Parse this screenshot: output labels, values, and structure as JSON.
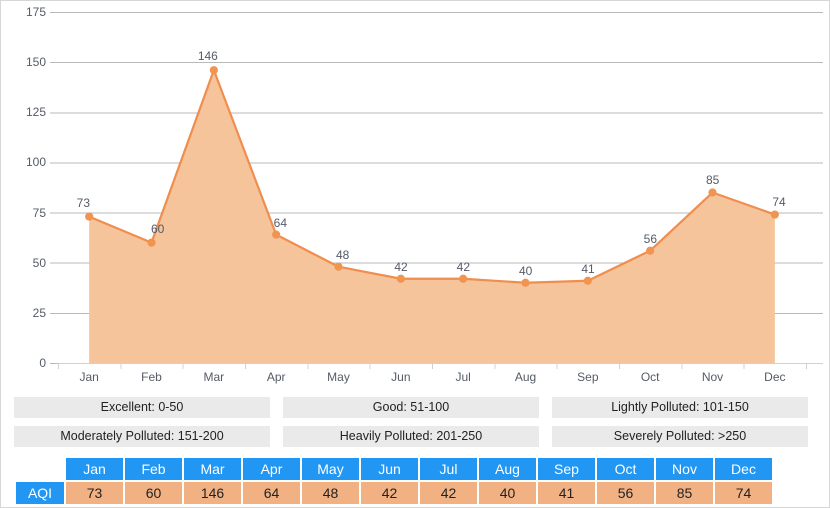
{
  "chart_data": {
    "type": "area",
    "title": "",
    "subtitle": "",
    "xlabel": "",
    "ylabel": "",
    "categories": [
      "Jan",
      "Feb",
      "Mar",
      "Apr",
      "May",
      "Jun",
      "Jul",
      "Aug",
      "Sep",
      "Oct",
      "Nov",
      "Dec"
    ],
    "series": [
      {
        "name": "AQI",
        "values": [
          73,
          60,
          146,
          64,
          48,
          42,
          42,
          40,
          41,
          56,
          85,
          74
        ]
      }
    ],
    "ylim": [
      0,
      175
    ],
    "yticks": [
      0,
      25,
      50,
      75,
      100,
      125,
      150,
      175
    ],
    "ytick_labels": [
      "0",
      "25",
      "50",
      "75",
      "100",
      "125",
      "150",
      "175"
    ],
    "grid": true,
    "legend_position": "below-chart",
    "data_labels": [
      "73",
      "60",
      "146",
      "64",
      "48",
      "42",
      "42",
      "40",
      "41",
      "56",
      "85",
      "74"
    ],
    "colors": {
      "line": "#ef8e4e",
      "marker": "#f09452",
      "area_fill": "#f5c49a",
      "gridline": "#b9b9b9",
      "axis": "#c8d4dc",
      "tick_text": "#555b66",
      "legend_bg": "#eaeaea",
      "table_header": "#2196f3",
      "table_cell": "#f2b183"
    }
  },
  "legend": {
    "items": [
      "Excellent: 0-50",
      "Good: 51-100",
      "Lightly Polluted: 101-150",
      "Moderately Polluted: 151-200",
      "Heavily Polluted: 201-250",
      "Severely Polluted: >250"
    ]
  },
  "table": {
    "corner_label": "",
    "columns": [
      "Jan",
      "Feb",
      "Mar",
      "Apr",
      "May",
      "Jun",
      "Jul",
      "Aug",
      "Sep",
      "Oct",
      "Nov",
      "Dec"
    ],
    "rows": [
      {
        "label": "AQI",
        "values": [
          "73",
          "60",
          "146",
          "64",
          "48",
          "42",
          "42",
          "40",
          "41",
          "56",
          "85",
          "74"
        ]
      }
    ]
  }
}
